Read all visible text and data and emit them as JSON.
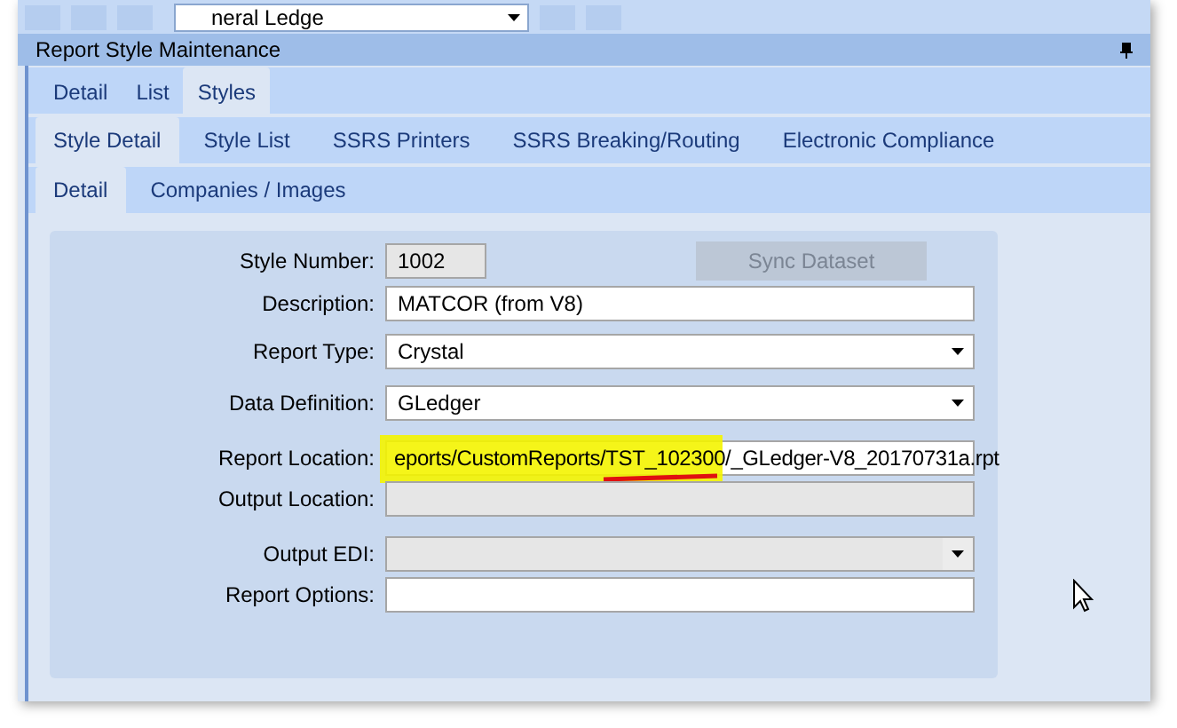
{
  "toolbar": {
    "combo_value": "neral Ledge"
  },
  "panel": {
    "title": "Report Style Maintenance"
  },
  "tabs": [
    {
      "label": "Detail",
      "selected": false
    },
    {
      "label": "List",
      "selected": false
    },
    {
      "label": "Styles",
      "selected": true
    }
  ],
  "sub_tabs": [
    {
      "label": "Style Detail",
      "selected": true
    },
    {
      "label": "Style List",
      "selected": false
    },
    {
      "label": "SSRS Printers",
      "selected": false
    },
    {
      "label": "SSRS Breaking/Routing",
      "selected": false
    },
    {
      "label": "Electronic Compliance",
      "selected": false
    }
  ],
  "detail_tabs": [
    {
      "label": "Detail",
      "selected": true
    },
    {
      "label": "Companies / Images",
      "selected": false
    }
  ],
  "sync_button": {
    "label": "Sync Dataset",
    "disabled": true
  },
  "fields": [
    {
      "label": "Style Number:",
      "kind": "short",
      "value": "1002",
      "disabled": true
    },
    {
      "label": "Description:",
      "kind": "text",
      "value": "MATCOR (from V8)",
      "disabled": false
    },
    {
      "label": "Report Type:",
      "kind": "dropdown",
      "value": "Crystal",
      "disabled": false
    },
    {
      "label": "Data Definition:",
      "kind": "dropdown",
      "value": "GLedger",
      "disabled": false
    },
    {
      "label": "Report Location:",
      "kind": "text",
      "value": "eports/CustomReports/TST_102300/_GLedger-V8_20170731a.rpt",
      "disabled": false,
      "highlighted": true
    },
    {
      "label": "Output Location:",
      "kind": "text",
      "disabled": true
    },
    {
      "label": "Output EDI:",
      "kind": "dropdown",
      "disabled": true
    },
    {
      "label": "Report Options:",
      "kind": "text",
      "disabled": false
    }
  ]
}
